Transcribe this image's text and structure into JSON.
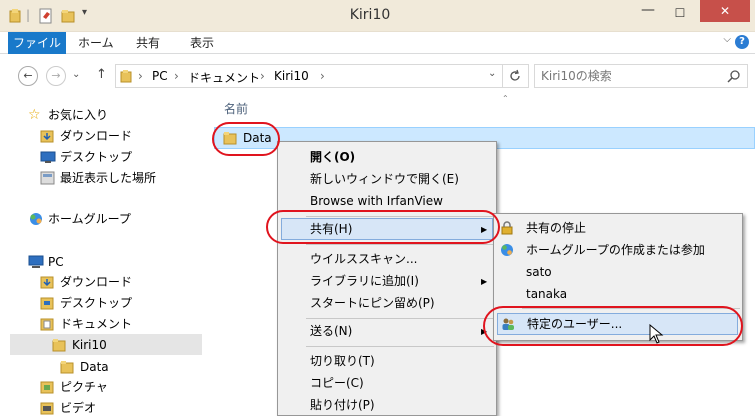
{
  "window": {
    "title": "Kiri10"
  },
  "title_controls": {
    "minimize": "—",
    "maximize": "☐",
    "close": "✕"
  },
  "ribbon": {
    "file": "ファイル",
    "tabs": [
      "ホーム",
      "共有",
      "表示"
    ],
    "expand": "⌵",
    "help": "?"
  },
  "nav": {
    "back": "←",
    "forward": "→",
    "recent": "⌄",
    "up": "↑"
  },
  "address": {
    "segments": [
      "PC",
      "ドキュメント",
      "Kiri10"
    ],
    "sep": "›"
  },
  "search": {
    "placeholder": "Kiri10の検索"
  },
  "nav_pane": {
    "favorites": "お気に入り",
    "fav_items": [
      "ダウンロード",
      "デスクトップ",
      "最近表示した場所"
    ],
    "homegroup": "ホームグループ",
    "pc": "PC",
    "pc_items": [
      "ダウンロード",
      "デスクトップ",
      "ドキュメント"
    ],
    "kiri10": "Kiri10",
    "data": "Data",
    "more": [
      "ピクチャ",
      "ビデオ"
    ]
  },
  "content": {
    "column_name": "名前",
    "item": "Data"
  },
  "context_menu": {
    "open": "開く(O)",
    "open_new": "新しいウィンドウで開く(E)",
    "irfan": "Browse with IrfanView",
    "share": "共有(H)",
    "virus": "ウイルススキャン...",
    "library": "ライブラリに追加(I)",
    "pin": "スタートにピン留め(P)",
    "send": "送る(N)",
    "cut": "切り取り(T)",
    "copy": "コピー(C)",
    "paste": "貼り付け(P)"
  },
  "share_menu": {
    "stop": "共有の停止",
    "homegroup": "ホームグループの作成または参加",
    "user1": "sato",
    "user2": "tanaka",
    "specific": "特定のユーザー..."
  },
  "colors": {
    "accent": "#1979ca",
    "highlight": "#cce8ff",
    "annotation": "#e0141e",
    "folder": "#e8c25a"
  }
}
